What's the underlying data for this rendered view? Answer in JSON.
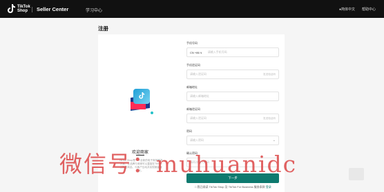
{
  "header": {
    "brand_line1": "TikTok",
    "brand_line2": "Shop",
    "seller_center": "Seller Center",
    "learning_center": "学习中心",
    "right_items": [
      "●简体中文",
      "帮助中心"
    ],
    "bg_color": "#111111"
  },
  "page": {
    "title": "注册"
  },
  "left_panel": {
    "welcome": "欢迎商家",
    "description": "TikTok Shop是一个全新的电子商务解决方案，让品牌与商家可以直接在TikTok上销售商品、与客户互动并实现销量增长。"
  },
  "form": {
    "fields": [
      {
        "label": "手机号码",
        "prefix": "CN +86 ∨",
        "placeholder": "请输入手机号码",
        "suffix": ""
      },
      {
        "label": "手机验证码",
        "placeholder": "请输入验证码",
        "suffix": "发送验证码"
      },
      {
        "label": "邮箱地址",
        "placeholder": "请输入邮箱地址",
        "suffix": ""
      },
      {
        "label": "邮箱验证码",
        "placeholder": "请输入验证码",
        "suffix": "发送验证码"
      },
      {
        "label": "密码",
        "placeholder": "请输入密码",
        "suffix": ""
      },
      {
        "label": "确认密码",
        "placeholder": "请再次输入密码",
        "suffix": ""
      }
    ],
    "submit_label": "下一步",
    "agree_text": "□ 我已阅读 TikTok Shop 及 TikTok For Business 服务条款",
    "agree_link": "登录"
  },
  "watermark": "微信号：muhuanidc",
  "colors": {
    "primary": "#0e7a6f",
    "accent": "#fe2c55"
  }
}
